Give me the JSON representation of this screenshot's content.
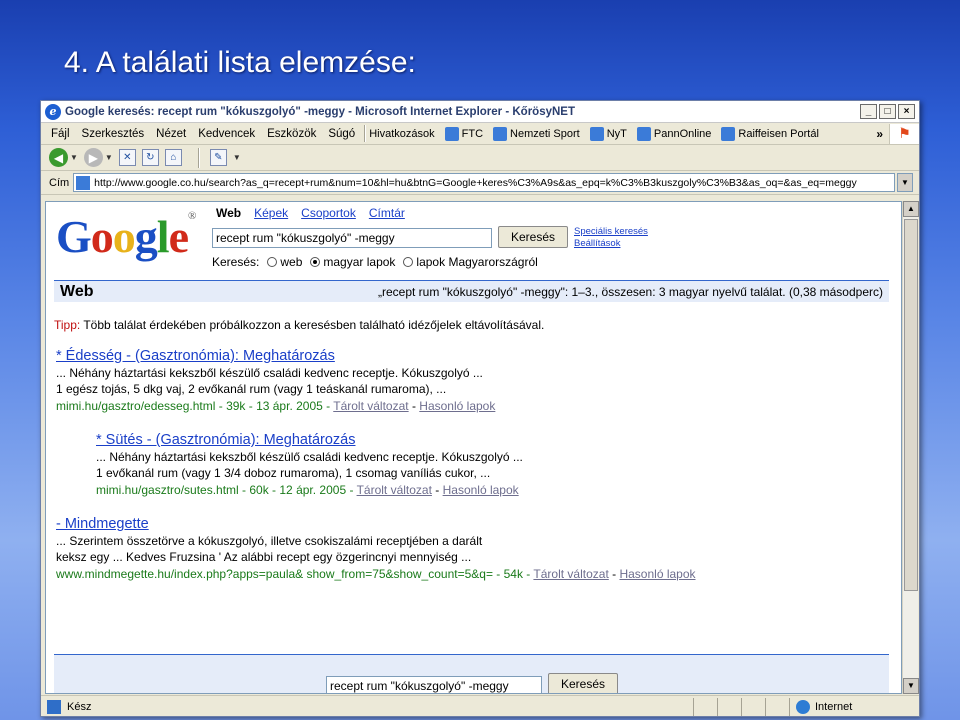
{
  "slide_title": "4. A találati lista elemzése:",
  "window": {
    "title": "Google keresés: recept rum \"kókuszgolyó\" -meggy - Microsoft Internet Explorer - KőrösyNET",
    "buttons": {
      "min": "_",
      "max": "□",
      "close": "×"
    }
  },
  "menu": {
    "items": [
      "Fájl",
      "Szerkesztés",
      "Nézet",
      "Kedvencek",
      "Eszközök",
      "Súgó"
    ],
    "links": [
      "Hivatkozások",
      "FTC",
      "Nemzeti Sport",
      "NyT",
      "PannOnline",
      "Raiffeisen Portál"
    ],
    "more": "»"
  },
  "address": {
    "label": "Cím",
    "url": "http://www.google.co.hu/search?as_q=recept+rum&num=10&hl=hu&btnG=Google+keres%C3%A9s&as_epq=k%C3%B3kuszgoly%C3%B3&as_oq=&as_eq=meggy"
  },
  "google": {
    "tabs": [
      "Web",
      "Képek",
      "Csoportok",
      "Címtár"
    ],
    "query": "recept rum \"kókuszgolyó\" -meggy",
    "search_button": "Keresés",
    "adv_search": "Speciális keresés",
    "settings": "Beállítások",
    "radio_label": "Keresés:",
    "radio_options": [
      "web",
      "magyar lapok",
      "lapok Magyarországról"
    ],
    "bar_title": "Web",
    "stats": "„recept rum \"kókuszgolyó\" -meggy\": 1–3., összesen: 3 magyar nyelvű találat. (0,38 másodperc)",
    "tip_label": "Tipp:",
    "tip_text": " Több találat érdekében próbálkozzon a keresésben található idézőjelek eltávolításával."
  },
  "results": [
    {
      "title": "* Édesség - (Gasztronómia): Meghatározás",
      "line1": "... Néhány háztartási kekszből készülő családi kedvenc receptje. Kókuszgolyó ...",
      "line2": "1 egész tojás, 5 dkg vaj, 2 evőkanál rum (vagy 1 teáskanál rumaroma), ...",
      "url": "mimi.hu/gasztro/edesseg.html - 39k - 13 ápr. 2005 - ",
      "cached": "Tárolt változat",
      "similar": "Hasonló lapok"
    },
    {
      "title": "* Sütés - (Gasztronómia): Meghatározás",
      "line1": "... Néhány háztartási kekszből készülő családi kedvenc receptje. Kókuszgolyó ...",
      "line2": "1 evőkanál rum (vagy 1 3/4 doboz rumaroma), 1 csomag vaníliás cukor, ...",
      "url": "mimi.hu/gasztro/sutes.html - 60k - 12 ápr. 2005 - ",
      "cached": "Tárolt változat",
      "similar": "Hasonló lapok"
    },
    {
      "title": "- Mindmegette",
      "line1": "... Szerintem összetörve a kókuszgolyó, illetve csokiszalámi receptjében a darált",
      "line2": "keksz egy ... Kedves Fruzsina ' Az alábbi recept egy özgerincnyi mennyiség ...",
      "url": "www.mindmegette.hu/index.php?apps=paula& show_from=75&show_count=5&q= - 54k - ",
      "cached": "Tárolt változat",
      "similar": "Hasonló lapok"
    }
  ],
  "bottom": {
    "query": "recept rum \"kókuszgolyó\" -meggy",
    "button": "Keresés"
  },
  "status": {
    "left": "Kész",
    "zone": "Internet"
  }
}
